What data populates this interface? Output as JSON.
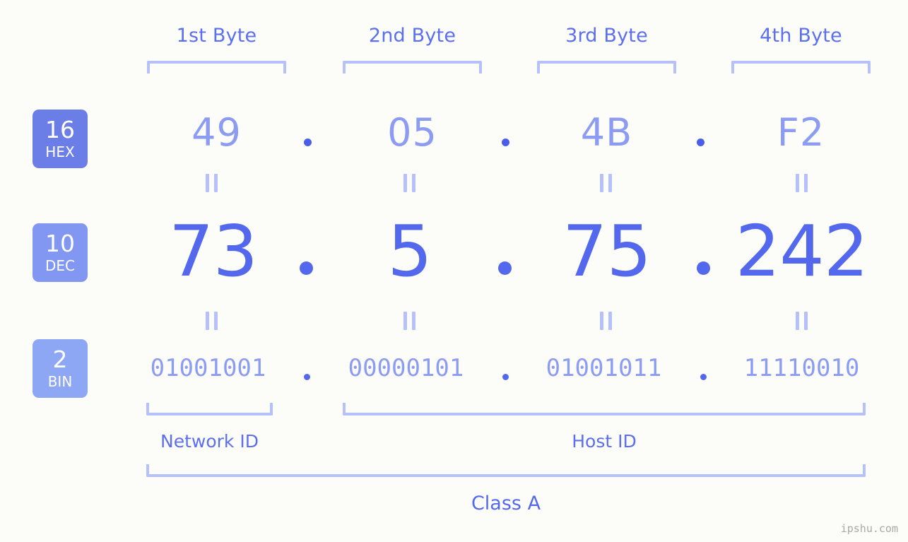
{
  "background_color": "#fcfdf8",
  "accent_color": "#5468ee",
  "accent_light_color": "#8d9cf3",
  "bracket_color": "#b6c0fb",
  "byte_headers": [
    {
      "label": "1st Byte"
    },
    {
      "label": "2nd Byte"
    },
    {
      "label": "3rd Byte"
    },
    {
      "label": "4th Byte"
    }
  ],
  "rows": {
    "hex": {
      "badge_number": "16",
      "badge_abbr": "HEX",
      "badge_color": "#6b7ee8",
      "values": [
        "49",
        "05",
        "4B",
        "F2"
      ],
      "separator": "."
    },
    "dec": {
      "badge_number": "10",
      "badge_abbr": "DEC",
      "badge_color": "#8197f2",
      "values": [
        "73",
        "5",
        "75",
        "242"
      ],
      "separator": "."
    },
    "bin": {
      "badge_number": "2",
      "badge_abbr": "BIN",
      "badge_color": "#8da7f5",
      "values": [
        "01001001",
        "00000101",
        "01001011",
        "11110010"
      ],
      "separator": "."
    }
  },
  "equals_symbol": "||",
  "segments": [
    {
      "label": "Network ID"
    },
    {
      "label": "Host ID"
    }
  ],
  "class_label": "Class A",
  "watermark": "ipshu.com",
  "ip_address": {
    "hex": "49.05.4B.F2",
    "dec": "73.5.75.242",
    "bin": "01001001.00000101.01001011.11110010"
  }
}
